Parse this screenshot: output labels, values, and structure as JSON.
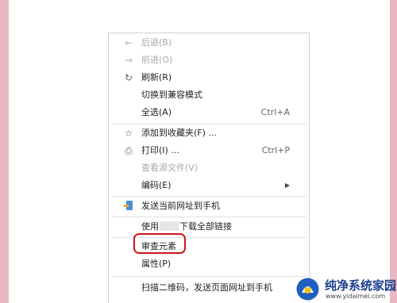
{
  "menu": {
    "items": [
      {
        "label": "后退(B)",
        "icon": "back-arrow",
        "glyph": "←"
      },
      {
        "label": "前进(O)",
        "icon": "forward-arrow",
        "glyph": "→"
      },
      {
        "label": "刷新(R)",
        "icon": "refresh",
        "glyph": "↻"
      },
      {
        "label": "切换到兼容模式"
      },
      {
        "label": "全选(A)",
        "shortcut": "Ctrl+A"
      },
      {
        "label": "添加到收藏夹(F) ...",
        "icon": "star",
        "glyph": "☆"
      },
      {
        "label": "打印(I) ...",
        "icon": "printer",
        "glyph": "⎙",
        "shortcut": "Ctrl+P"
      },
      {
        "label": "查看源文件(V)"
      },
      {
        "label": "编码(E)",
        "submenu": "▶"
      },
      {
        "label": "发送当前网址到手机",
        "icon": "send-to-phone",
        "glyph": "▣"
      },
      {
        "label_before": "使用",
        "label_after": "下载全部链接"
      },
      {
        "label": "审查元素"
      },
      {
        "label": "属性(P)"
      },
      {
        "label": "扫描二维码，发送页面网址到手机"
      }
    ]
  },
  "watermark": {
    "title": "纯净系统家园",
    "url": "www.yidaimei.com"
  },
  "colors": {
    "highlight": "#c8161d",
    "background_border": "#e9b8c3"
  }
}
